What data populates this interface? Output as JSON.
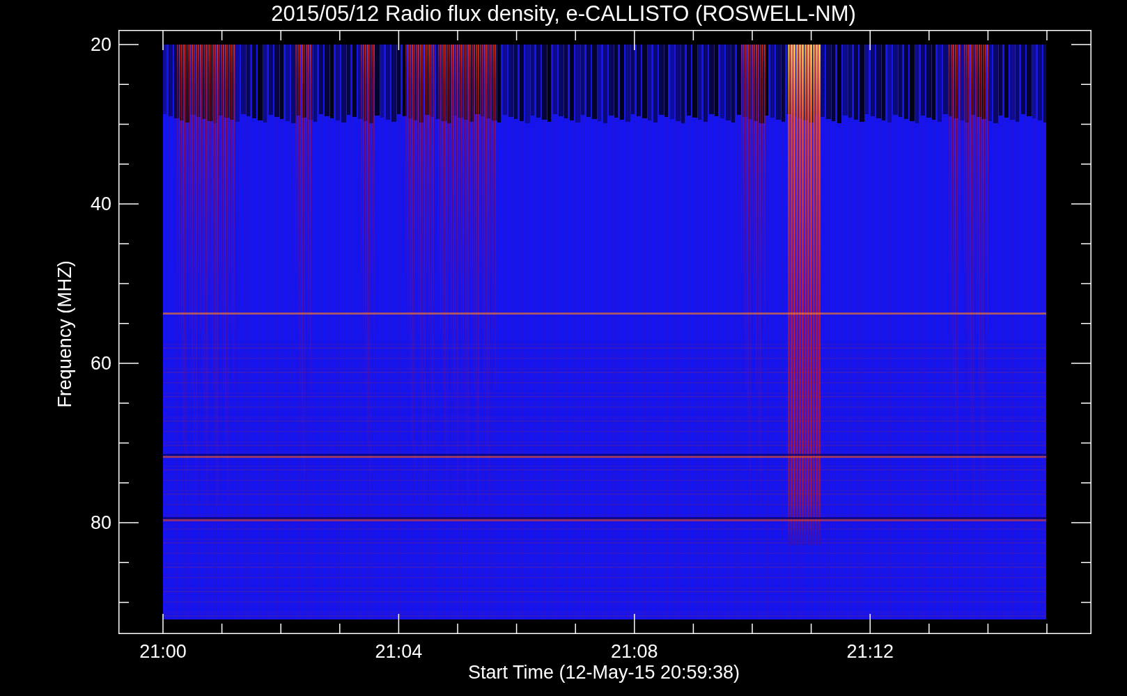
{
  "chart": {
    "title": "2015/05/12  Radio flux density, e-CALLISTO (ROSWELL-NM)",
    "ylabel": "Frequency (MHZ)",
    "xlabel": "Start Time (12-May-15 20:59:38)",
    "yticks": [
      "20",
      "40",
      "60",
      "80"
    ],
    "xticks": [
      "21:00",
      "21:04",
      "21:08",
      "21:12"
    ]
  }
}
